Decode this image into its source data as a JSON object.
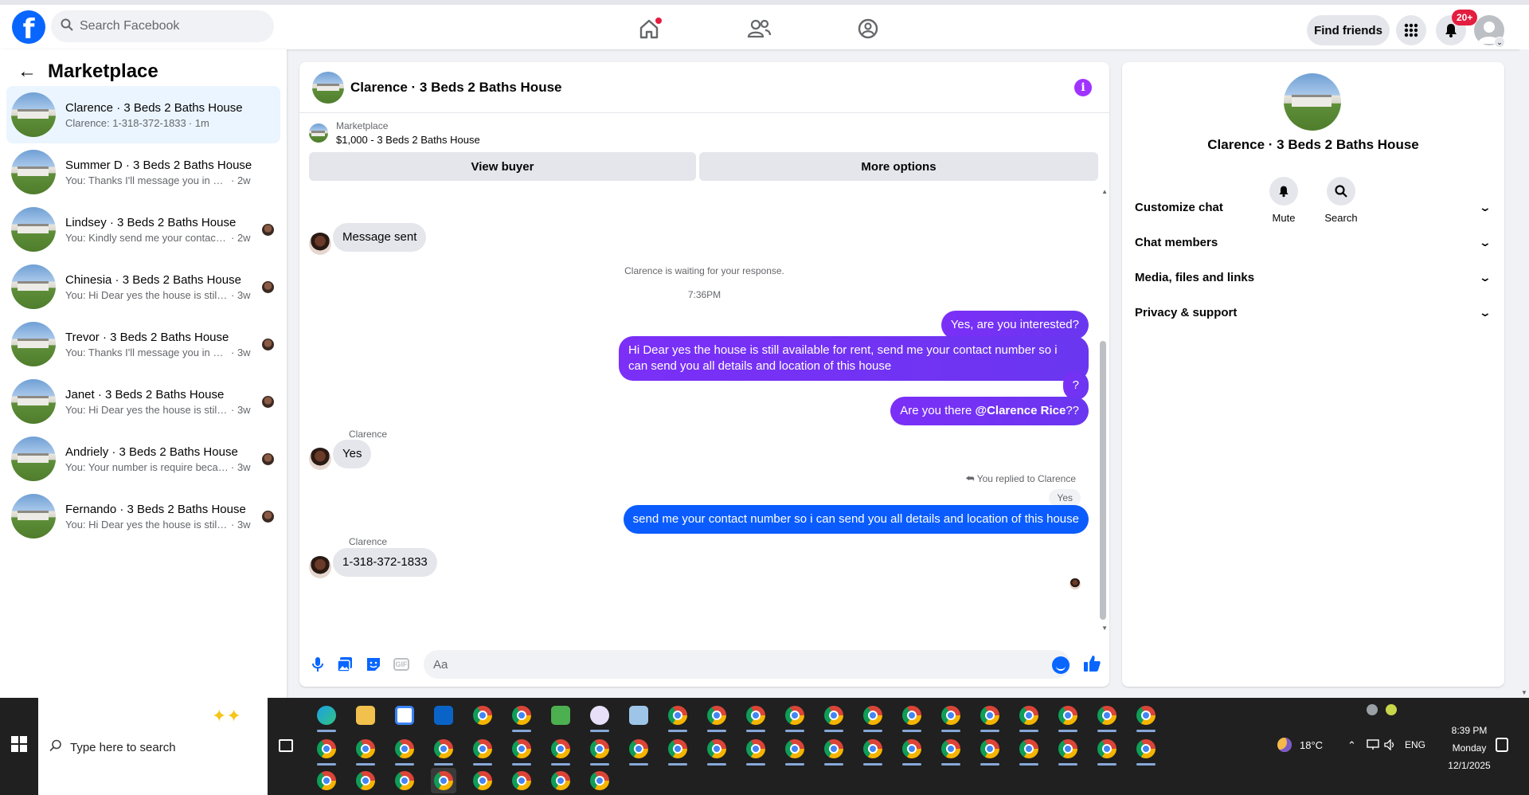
{
  "topbar": {
    "logo": "f",
    "search_placeholder": "Search Facebook",
    "find_friends": "Find friends",
    "notification_count": "20+"
  },
  "sidebar": {
    "title": "Marketplace",
    "conversations": [
      {
        "title": "Clarence · 3 Beds 2 Baths House",
        "snippet": "Clarence: 1-318-372-1833",
        "time": "· 1m",
        "active": true
      },
      {
        "title": "Summer D · 3 Beds 2 Baths House",
        "snippet": "You: Thanks I'll message you in a mo...",
        "time": "· 2w"
      },
      {
        "title": "Lindsey · 3 Beds 2 Baths House",
        "snippet": "You: Kindly send me your contact ...",
        "time": "· 2w"
      },
      {
        "title": "Chinesia · 3 Beds 2 Baths House",
        "snippet": "You: Hi Dear yes the house is still a...",
        "time": "· 3w"
      },
      {
        "title": "Trevor · 3 Beds 2 Baths House",
        "snippet": "You: Thanks I'll message you in a ...",
        "time": "· 3w"
      },
      {
        "title": "Janet · 3 Beds 2 Baths House",
        "snippet": "You: Hi Dear yes the house is still a...",
        "time": "· 3w"
      },
      {
        "title": "Andriely · 3 Beds 2 Baths House",
        "snippet": "You: Your number is require becau...",
        "time": "· 3w"
      },
      {
        "title": "Fernando · 3 Beds 2 Baths House",
        "snippet": "You: Hi Dear yes the house is still a...",
        "time": "· 3w"
      }
    ]
  },
  "chat": {
    "title": "Clarence · 3 Beds 2 Baths House",
    "marketplace_label": "Marketplace",
    "listing": "$1,000 - 3 Beds 2 Baths House",
    "view_buyer": "View buyer",
    "more_options": "More options",
    "messages": {
      "message_sent": "Message sent",
      "waiting_note": "Clarence is waiting for your response.",
      "timestamp": "7:36PM",
      "out1": "Yes, are you interested?",
      "out2": "Hi Dear yes the house is still available for rent, send me your contact number so i can send you all details and location of this house",
      "out3": "?",
      "out4_prefix": "Are you there ",
      "out4_mention": "@Clarence Rice",
      "out4_suffix": "??",
      "sender": "Clarence",
      "in1": "Yes",
      "reply_note": "You replied to Clarence",
      "reply_quote": "Yes",
      "out5": "send me your contact number so i can send you all details and location of this house",
      "in2": "1-318-372-1833"
    },
    "composer_placeholder": "Aa",
    "gif_label": "GIF"
  },
  "info_panel": {
    "title": "Clarence · 3 Beds 2 Baths House",
    "mute": "Mute",
    "search": "Search",
    "sections": [
      "Customize chat",
      "Chat members",
      "Media, files and links",
      "Privacy & support"
    ]
  },
  "taskbar": {
    "search_placeholder": "Type here to search",
    "temperature": "18°C",
    "language": "ENG",
    "time": "8:39 PM",
    "day": "Monday",
    "date": "12/1/2025"
  }
}
